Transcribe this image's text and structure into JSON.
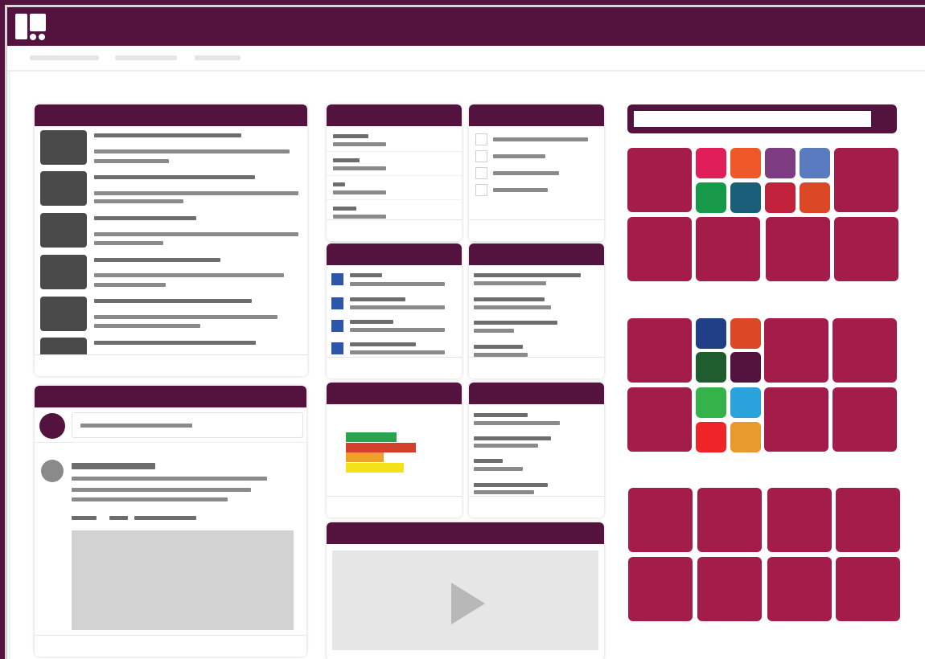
{
  "app": {
    "accent": "#54133f",
    "tile_color": "#a31c4a"
  },
  "search": {
    "placeholder": "",
    "icon": "search-icon"
  },
  "subnav": {
    "items": [
      "",
      "",
      ""
    ]
  },
  "chart_widget": {
    "bar_colors": [
      "#2aa34a",
      "#d2402b",
      "#f0a02a",
      "#f4e11b"
    ]
  },
  "app_grid_1": {
    "small_tile_colors": [
      "#e01f5a",
      "#ef5828",
      "#7d3b82",
      "#5b7bc0",
      "#169a4a",
      "#1a5e7a",
      "#c1213a",
      "#dc4726"
    ]
  },
  "app_grid_2": {
    "small_tile_colors": [
      "#213f86",
      "#dc4726",
      "#1f5c2e",
      "#54133f",
      "#35b34a",
      "#2aa3dc",
      "#ee2428",
      "#e89a2c"
    ]
  },
  "video": {
    "icon": "play-icon"
  }
}
